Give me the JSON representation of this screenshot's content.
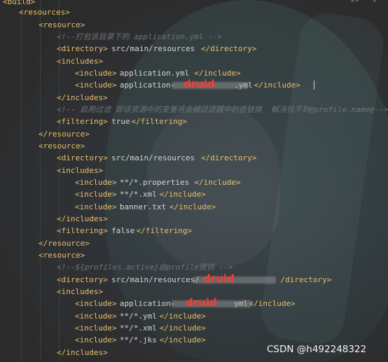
{
  "editor": {
    "top_counter": "10",
    "lines": [
      {
        "tokens": [
          {
            "t": "tag",
            "v": "<build>"
          }
        ]
      },
      {
        "tokens": [
          {
            "t": "tag",
            "v": "<resources>"
          }
        ]
      },
      {
        "tokens": [
          {
            "t": "tag",
            "v": "<resource>"
          }
        ]
      },
      {
        "tokens": [
          {
            "t": "cmt",
            "v": "<!--打包该目录下的 application.yml -->"
          }
        ]
      },
      {
        "tokens": [
          {
            "t": "tag",
            "v": "<directory>"
          },
          {
            "t": "txt",
            "v": "src/main/resources"
          },
          {
            "t": "tag",
            "v": "</directory>"
          }
        ]
      },
      {
        "tokens": [
          {
            "t": "tag",
            "v": "<includes>"
          }
        ]
      },
      {
        "tokens": [
          {
            "t": "tag",
            "v": "<include>"
          },
          {
            "t": "txt",
            "v": "application.yml"
          },
          {
            "t": "tag",
            "v": "</include>"
          }
        ]
      },
      {
        "tokens": [
          {
            "t": "tag",
            "v": "<include>"
          },
          {
            "t": "txt",
            "v": "application-"
          },
          {
            "t": "txt",
            "v": "           "
          },
          {
            "t": "txt",
            "v": ".yml"
          },
          {
            "t": "tag",
            "v": "</include>"
          }
        ]
      },
      {
        "tokens": [
          {
            "t": "tag",
            "v": "</includes>"
          }
        ]
      },
      {
        "tokens": [
          {
            "t": "cmt",
            "v": "<!-- 启用过滤 即该资源中的变量将会被过滤器中的值替换  解决找不到@profile.name@-->"
          }
        ]
      },
      {
        "tokens": [
          {
            "t": "tag",
            "v": "<filtering>"
          },
          {
            "t": "txt",
            "v": "true"
          },
          {
            "t": "tag",
            "v": "</filtering>"
          }
        ]
      },
      {
        "tokens": [
          {
            "t": "tag",
            "v": "</resource>"
          }
        ]
      },
      {
        "tokens": [
          {
            "t": "tag",
            "v": "<resource>"
          }
        ]
      },
      {
        "tokens": [
          {
            "t": "tag",
            "v": "<directory>"
          },
          {
            "t": "txt",
            "v": "src/main/resources"
          },
          {
            "t": "tag",
            "v": "</directory>"
          }
        ]
      },
      {
        "tokens": [
          {
            "t": "tag",
            "v": "<includes>"
          }
        ]
      },
      {
        "tokens": [
          {
            "t": "tag",
            "v": "<include>"
          },
          {
            "t": "txt",
            "v": "**/*.properties"
          },
          {
            "t": "tag",
            "v": "</include>"
          }
        ]
      },
      {
        "tokens": [
          {
            "t": "tag",
            "v": "<include>"
          },
          {
            "t": "txt",
            "v": "**/*.xml"
          },
          {
            "t": "tag",
            "v": "</include>"
          }
        ]
      },
      {
        "tokens": [
          {
            "t": "tag",
            "v": "<include>"
          },
          {
            "t": "txt",
            "v": "banner.txt"
          },
          {
            "t": "tag",
            "v": "</include>"
          }
        ]
      },
      {
        "tokens": [
          {
            "t": "tag",
            "v": "</includes>"
          }
        ]
      },
      {
        "tokens": [
          {
            "t": "tag",
            "v": "<filtering>"
          },
          {
            "t": "txt",
            "v": "false"
          },
          {
            "t": "tag",
            "v": "</filtering>"
          }
        ]
      },
      {
        "tokens": [
          {
            "t": "tag",
            "v": "</resource>"
          }
        ]
      },
      {
        "tokens": [
          {
            "t": "tag",
            "v": "<resource>"
          }
        ]
      },
      {
        "tokens": [
          {
            "t": "cmt",
            "v": "<!--${profiles.active}由profile提供 -->"
          }
        ]
      },
      {
        "tokens": [
          {
            "t": "tag",
            "v": "<directory>"
          },
          {
            "t": "txt",
            "v": "src/main/resources/"
          },
          {
            "t": "txt",
            "v": "               "
          },
          {
            "t": "tag",
            "v": "/directory>"
          }
        ]
      },
      {
        "tokens": [
          {
            "t": "tag",
            "v": "<includes>"
          }
        ]
      },
      {
        "tokens": [
          {
            "t": "tag",
            "v": "<include>"
          },
          {
            "t": "txt",
            "v": "application-"
          },
          {
            "t": "txt",
            "v": "           "
          },
          {
            "t": "txt",
            "v": "yml"
          },
          {
            "t": "tag",
            "v": "</include>"
          }
        ]
      },
      {
        "tokens": [
          {
            "t": "tag",
            "v": "<include>"
          },
          {
            "t": "txt",
            "v": "**/*.yml"
          },
          {
            "t": "tag",
            "v": "</include>"
          }
        ]
      },
      {
        "tokens": [
          {
            "t": "tag",
            "v": "<include>"
          },
          {
            "t": "txt",
            "v": "**/*.xml"
          },
          {
            "t": "tag",
            "v": "</include>"
          }
        ]
      },
      {
        "tokens": [
          {
            "t": "tag",
            "v": "<include>"
          },
          {
            "t": "txt",
            "v": "**/*.jks"
          },
          {
            "t": "tag",
            "v": "</include>"
          }
        ]
      },
      {
        "tokens": [
          {
            "t": "tag",
            "v": "</includes>"
          }
        ]
      }
    ]
  },
  "watermarks": {
    "druid": "druid",
    "csdn": "CSDN @h492248322"
  },
  "colors": {
    "background": "#2b2b2b",
    "tag": "#e8bf6a",
    "text": "#d4d4d4",
    "comment": "#6f737a",
    "druid_watermark": "#ff3b30"
  }
}
